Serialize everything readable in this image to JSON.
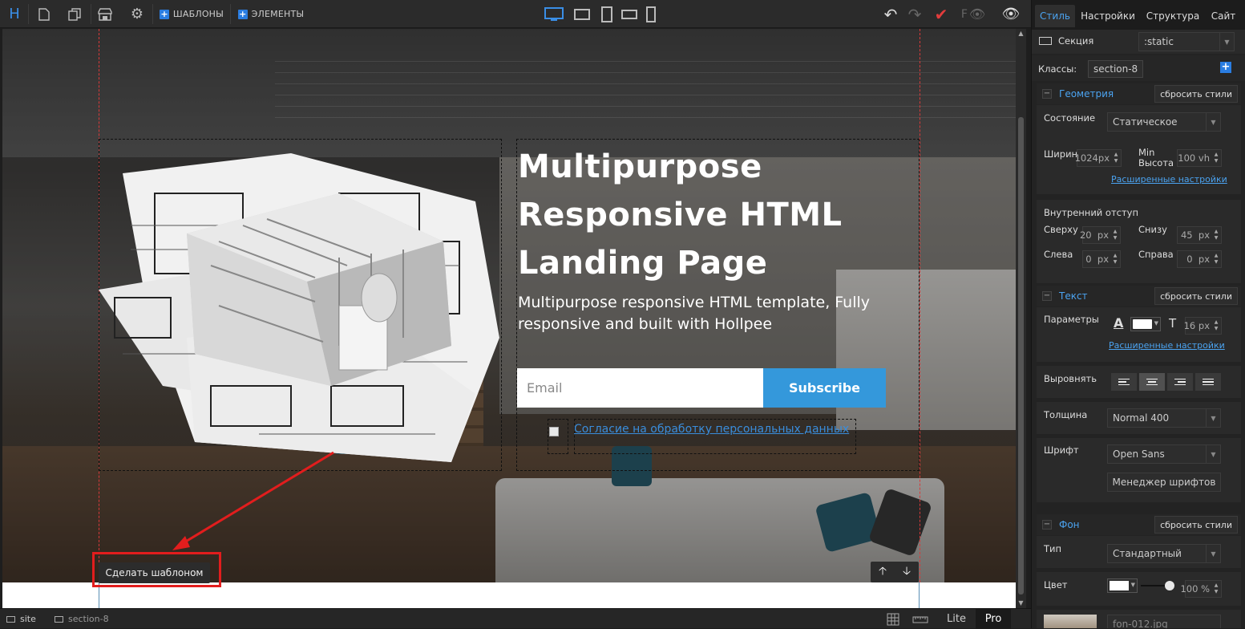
{
  "toolbar": {
    "logo": "H",
    "templates_label": "ШАБЛОНЫ",
    "elements_label": "ЭЛЕМЕНТЫ",
    "fb_label": "F"
  },
  "hero": {
    "title_line1": "Multipurpose",
    "title_line2": "Responsive HTML",
    "title_line3": "Landing Page",
    "subtitle": "Multipurpose responsive HTML template, Fully responsive and built with Hollpee",
    "email_placeholder": "Email",
    "subscribe_label": "Subscribe",
    "consent_link": "Согласие на обработку персональных данных"
  },
  "canvas": {
    "make_template_label": "Сделать шаблоном",
    "up_arrow": "🡡",
    "down_arrow": "🡣"
  },
  "status_bar": {
    "site": "site",
    "section": "section-8",
    "lite": "Lite",
    "pro": "Pro"
  },
  "panel": {
    "tabs": [
      "Стиль",
      "Настройки",
      "Структура",
      "Сайт"
    ],
    "element_type": "Секция",
    "position_value": ":static",
    "classes_label": "Классы:",
    "class_value": "section-8",
    "geometry": {
      "title": "Геометрия",
      "reset": "сбросить стили",
      "state_label": "Состояние",
      "state_value": "Статическое",
      "width_label": "Ширина",
      "width_value": "1024",
      "width_unit": "px",
      "min_height_label_1": "Min",
      "min_height_label_2": "Высота",
      "min_height_value": "100",
      "min_height_unit": "vh",
      "advanced": "Расширенные настройки",
      "padding_label": "Внутренний отступ",
      "top_label": "Сверху",
      "top_value": "20",
      "bottom_label": "Снизу",
      "bottom_value": "45",
      "left_label": "Слева",
      "left_value": "0",
      "right_label": "Справа",
      "right_value": "0",
      "unit_px": "px"
    },
    "text": {
      "title": "Текст",
      "reset": "сбросить стили",
      "params_label": "Параметры",
      "font_size": "16",
      "font_size_unit": "px",
      "advanced": "Расширенные настройки",
      "align_label": "Выровнять",
      "weight_label": "Толщина",
      "weight_value": "Normal 400",
      "font_label": "Шрифт",
      "font_value": "Open Sans",
      "font_manager": "Менеджер шрифтов"
    },
    "background": {
      "title": "Фон",
      "reset": "сбросить стили",
      "type_label": "Тип",
      "type_value": "Стандартный",
      "color_label": "Цвет",
      "opacity_value": "100",
      "opacity_unit": "%",
      "image_name": "fon-012.jpg"
    }
  },
  "colors": {
    "accent": "#3498db",
    "panel_accent": "#4ba3f0",
    "guide_red": "#d83a3a",
    "annotation_red": "#e21d1d"
  }
}
